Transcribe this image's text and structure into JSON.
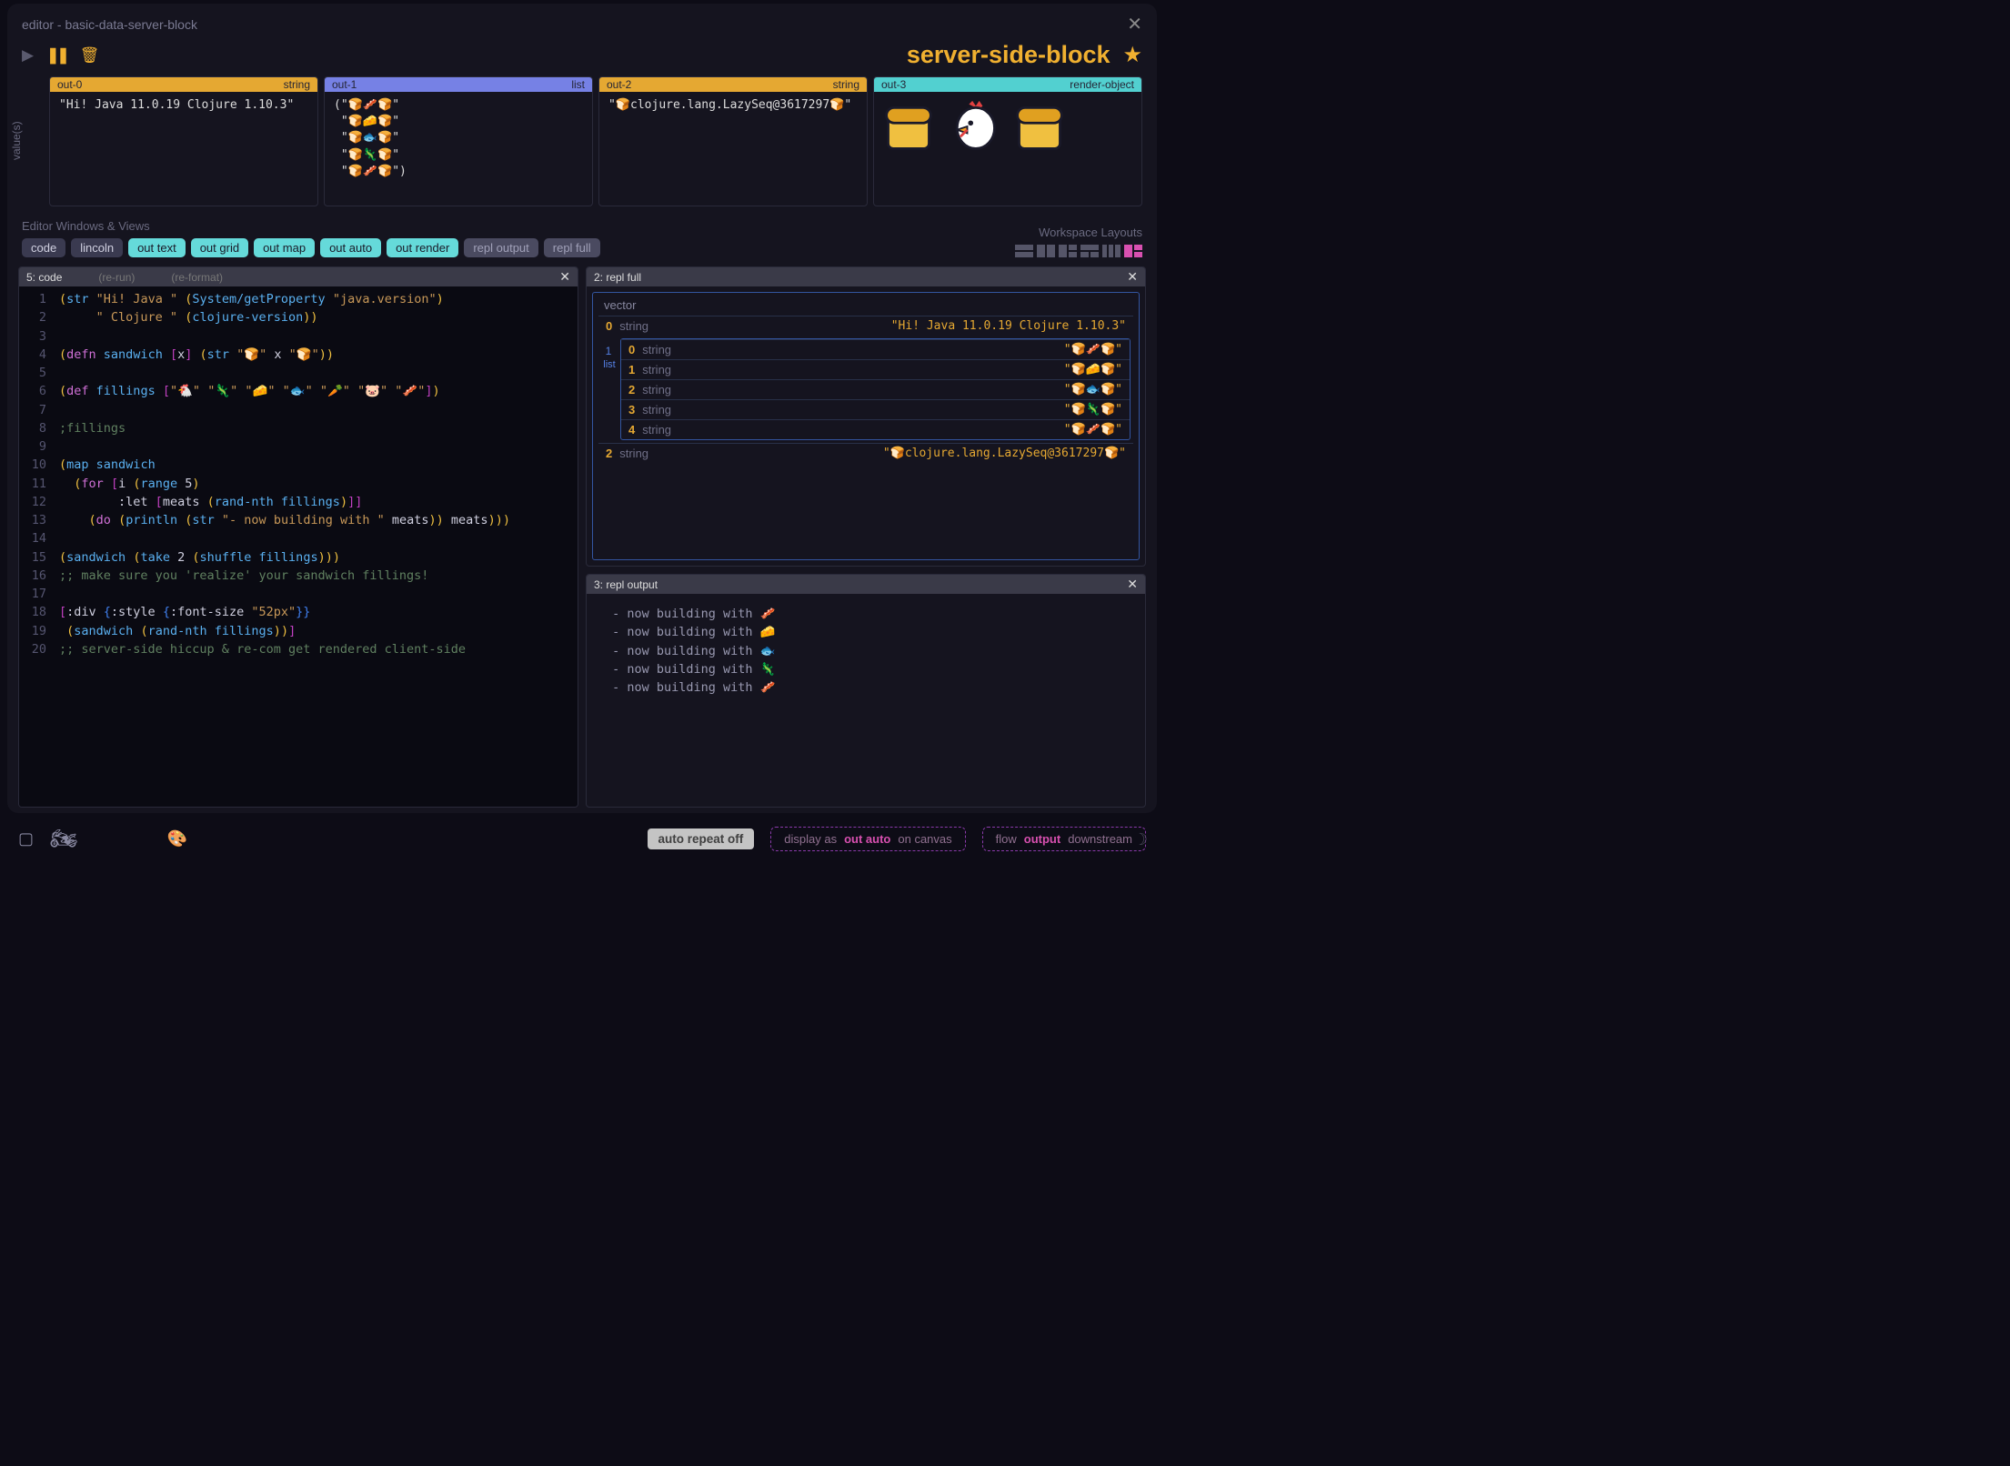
{
  "titlebar": "editor - basic-data-server-block",
  "page_title": "server-side-block",
  "controls": {
    "play": "▶",
    "pause": "❚❚",
    "trash": "🗑"
  },
  "outputs": [
    {
      "name": "out-0",
      "type": "string",
      "body": "\"Hi! Java 11.0.19 Clojure 1.10.3\""
    },
    {
      "name": "out-1",
      "type": "list",
      "body": "(\"🍞🥓🍞\"\n \"🍞🧀🍞\"\n \"🍞🐟🍞\"\n \"🍞🦎🍞\"\n \"🍞🥓🍞\")"
    },
    {
      "name": "out-2",
      "type": "string",
      "body": "\"🍞clojure.lang.LazySeq@3617297🍞\""
    },
    {
      "name": "out-3",
      "type": "render-object"
    }
  ],
  "editor_label": "Editor Windows & Views",
  "workspace_label": "Workspace Layouts",
  "tabs": [
    {
      "label": "code",
      "cls": "tab-a"
    },
    {
      "label": "lincoln",
      "cls": "tab-a"
    },
    {
      "label": "out text",
      "cls": "tab-b"
    },
    {
      "label": "out grid",
      "cls": "tab-b"
    },
    {
      "label": "out map",
      "cls": "tab-b"
    },
    {
      "label": "out auto",
      "cls": "tab-b"
    },
    {
      "label": "out render",
      "cls": "tab-b"
    },
    {
      "label": "repl output",
      "cls": "tab-c"
    },
    {
      "label": "repl full",
      "cls": "tab-c"
    }
  ],
  "code_panel": {
    "title": "5: code",
    "sub1": "(re-run)",
    "sub2": "(re-format)"
  },
  "code_lines": [
    "(str \"Hi! Java \" (System/getProperty \"java.version\")",
    "     \" Clojure \" (clojure-version))",
    "",
    "(defn sandwich [x] (str \"🍞\" x \"🍞\"))",
    "",
    "(def fillings [\"🐔\" \"🦎\" \"🧀\" \"🐟\" \"🥕\" \"🐷\" \"🥓\"])",
    "",
    ";fillings",
    "",
    "(map sandwich",
    "  (for [i (range 5)",
    "        :let [meats (rand-nth fillings)]]",
    "    (do (println (str \"- now building with \" meats)) meats)))",
    "",
    "(sandwich (take 2 (shuffle fillings)))",
    ";; make sure you 'realize' your sandwich fillings!",
    "",
    "[:div {:style {:font-size \"52px\"}}",
    " (sandwich (rand-nth fillings))]",
    ";; server-side hiccup & re-com get rendered client-side"
  ],
  "repl_full": {
    "title": "2: repl full",
    "label": "vector",
    "rows": [
      {
        "idx": "0",
        "type": "string",
        "val": "\"Hi! Java 11.0.19 Clojure 1.10.3\""
      },
      {
        "idx": "1",
        "type": "list",
        "nested": [
          {
            "idx": "0",
            "type": "string",
            "val": "\"🍞🥓🍞\""
          },
          {
            "idx": "1",
            "type": "string",
            "val": "\"🍞🧀🍞\""
          },
          {
            "idx": "2",
            "type": "string",
            "val": "\"🍞🐟🍞\""
          },
          {
            "idx": "3",
            "type": "string",
            "val": "\"🍞🦎🍞\""
          },
          {
            "idx": "4",
            "type": "string",
            "val": "\"🍞🥓🍞\""
          }
        ]
      },
      {
        "idx": "2",
        "type": "string",
        "val": "\"🍞clojure.lang.LazySeq@3617297🍞\""
      }
    ]
  },
  "repl_out": {
    "title": "3: repl output",
    "lines": [
      "- now building with 🥓",
      "- now building with 🧀",
      "- now building with 🐟",
      "- now building with 🦎",
      "- now building with 🥓"
    ]
  },
  "footer": {
    "auto": "auto repeat off",
    "display": {
      "a": "display as",
      "b": "out auto",
      "c": "on canvas"
    },
    "flow": {
      "a": "flow",
      "b": "output",
      "c": "downstream"
    }
  },
  "vlabel": "value(s)"
}
